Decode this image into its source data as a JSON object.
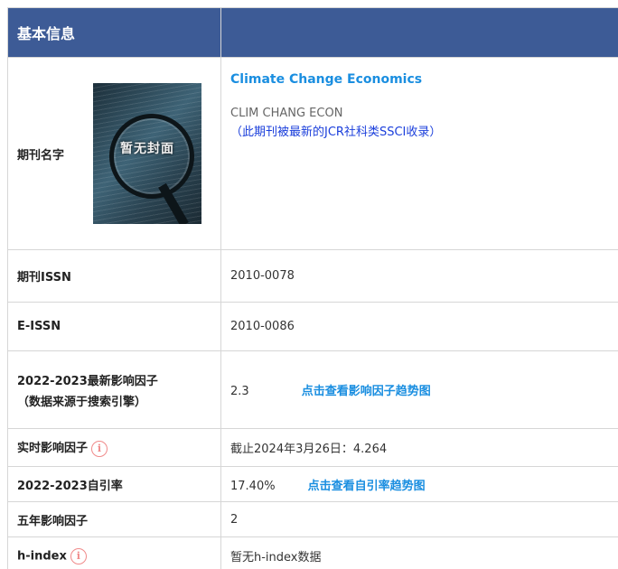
{
  "header": {
    "title": "基本信息"
  },
  "journal": {
    "label": "期刊名字",
    "cover_text": "暂无封面",
    "full_name": "Climate Change Economics",
    "abbr": "CLIM CHANG ECON",
    "note": "（此期刊被最新的JCR社科类SSCI收录）"
  },
  "rows": {
    "issn": {
      "label": "期刊ISSN",
      "value": "2010-0078"
    },
    "eissn": {
      "label": "E-ISSN",
      "value": "2010-0086"
    },
    "if": {
      "label_1": "2022-2023最新影响因子",
      "label_2": "（数据来源于搜索引擎）",
      "value": "2.3",
      "link": "点击查看影响因子趋势图"
    },
    "realtime_if": {
      "label": "实时影响因子",
      "value": "截止2024年3月26日：4.264"
    },
    "self_cite": {
      "label": "2022-2023自引率",
      "value": "17.40%",
      "link": "点击查看自引率趋势图"
    },
    "five_year_if": {
      "label": "五年影响因子",
      "value": "2"
    },
    "h_index": {
      "label": "h-index",
      "value": "暂无h-index数据"
    }
  },
  "icons": {
    "info": "info-circle-icon",
    "info_color": "#f08a8a"
  },
  "colors": {
    "header_bg": "#3d5b96",
    "link": "#1a8ee0",
    "note": "#1a3edb"
  }
}
